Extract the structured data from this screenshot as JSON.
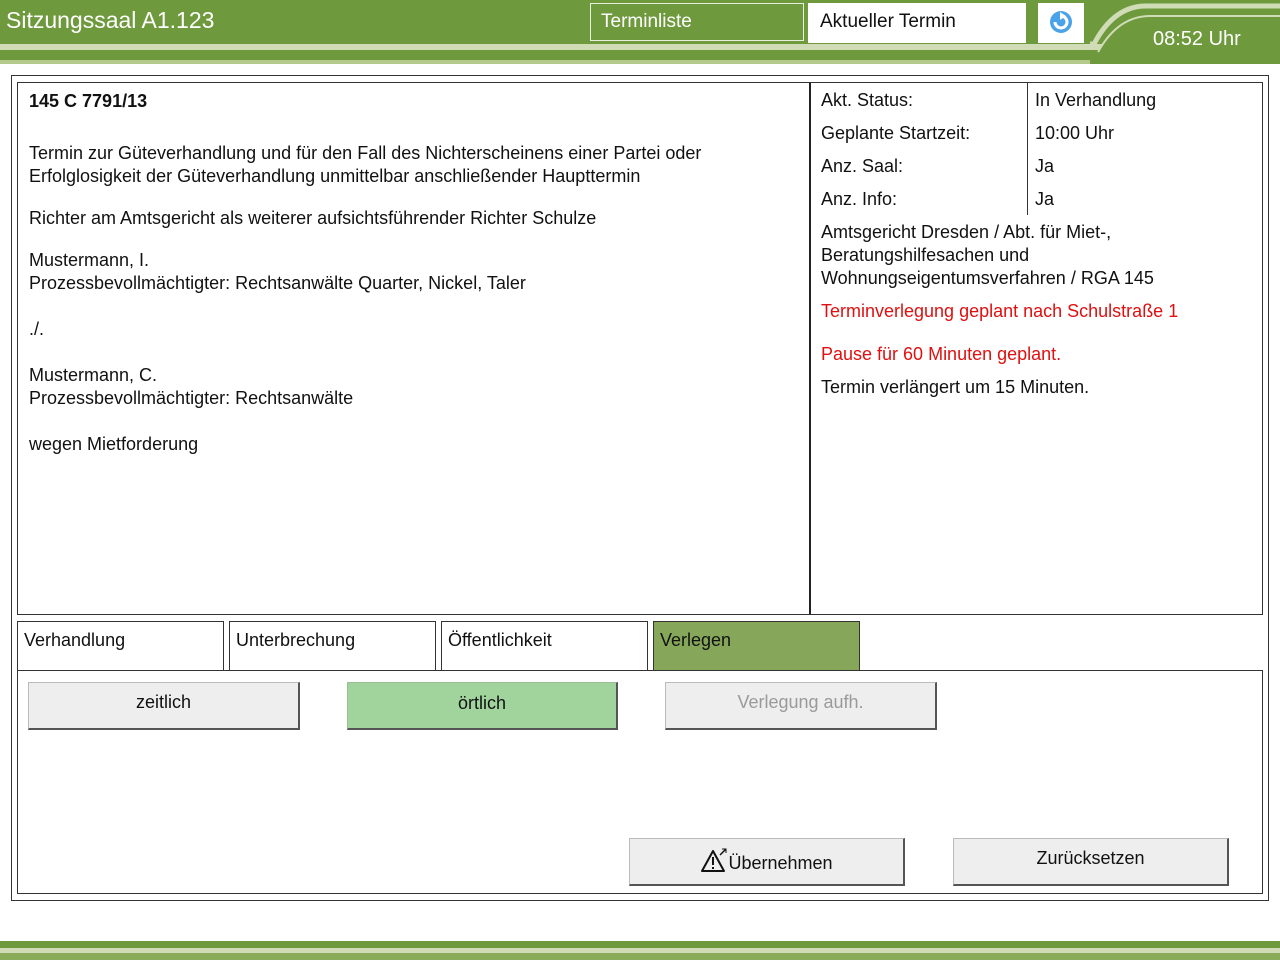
{
  "header": {
    "room_title": "Sitzungssaal A1.123",
    "tab_list_label": "Terminliste",
    "tab_current_label": "Aktueller Termin",
    "clock": "08:52 Uhr",
    "refresh_icon": "refresh-icon",
    "colors": {
      "brand_green": "#6e9a3d",
      "active_tab": "#86a75a"
    }
  },
  "case": {
    "number": "145 C 7791/13",
    "description_line1": "Termin zur Güteverhandlung und für den Fall des Nichterscheinens einer Partei oder",
    "description_line2": "Erfolglosigkeit der Güteverhandlung unmittelbar anschließender Haupttermin",
    "judge": "Richter am Amtsgericht als weiterer aufsichtsführender Richter Schulze",
    "party1_name": "Mustermann, I.",
    "party1_counsel": "Prozessbevollmächtigter: Rechtsanwälte Quarter, Nickel, Taler",
    "versus": "./.",
    "party2_name": "Mustermann, C.",
    "party2_counsel": "Prozessbevollmächtigter: Rechtsanwälte",
    "subject": "wegen Mietforderung"
  },
  "info": {
    "rows": [
      {
        "label": "Akt. Status:",
        "value": "In Verhandlung"
      },
      {
        "label": "Geplante Startzeit:",
        "value": "10:00 Uhr"
      },
      {
        "label": "Anz. Saal:",
        "value": "Ja"
      },
      {
        "label": "Anz. Info:",
        "value": "Ja"
      }
    ],
    "court_line1": "Amtsgericht Dresden / Abt. für Miet-,",
    "court_line2": "Beratungshilfesachen und",
    "court_line3": "Wohnungseigentumsverfahren / RGA 145",
    "notice_relocation": "Terminverlegung geplant nach Schulstraße 1",
    "notice_pause": "Pause für 60 Minuten geplant.",
    "notice_extension": "Termin verlängert um 15 Minuten.",
    "notice_color": "#e01010"
  },
  "tabs": [
    {
      "label": "Verhandlung"
    },
    {
      "label": "Unterbrechung"
    },
    {
      "label": "Öffentlichkeit"
    },
    {
      "label": "Verlegen",
      "active": true
    }
  ],
  "actions": {
    "temporal_label": "zeitlich",
    "local_label": "örtlich",
    "local_selected": true,
    "cancel_relocation_label": "Verlegung aufh.",
    "cancel_relocation_disabled": true,
    "apply_label": "Übernehmen",
    "apply_icon": "warning-icon",
    "reset_label": "Zurücksetzen"
  }
}
